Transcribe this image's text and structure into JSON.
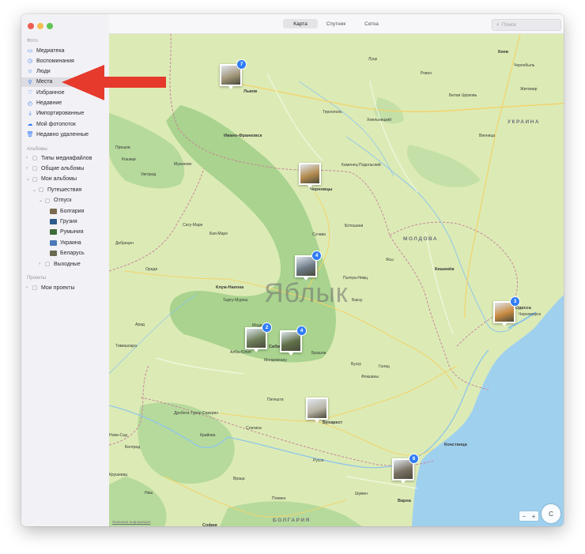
{
  "toolbar": {
    "tabs": [
      "Карта",
      "Спутник",
      "Сетка"
    ],
    "active_tab": 0,
    "search_placeholder": "Поиск"
  },
  "sidebar": {
    "sections": {
      "library": "Фото",
      "albums": "Альбомы",
      "projects": "Проекты"
    },
    "library_items": [
      {
        "label": "Медиатека",
        "icon": "photo-library-icon"
      },
      {
        "label": "Воспоминания",
        "icon": "memories-icon"
      },
      {
        "label": "Люди",
        "icon": "people-icon"
      },
      {
        "label": "Места",
        "icon": "places-pin-icon",
        "selected": true
      },
      {
        "label": "Избранное",
        "icon": "heart-icon"
      },
      {
        "label": "Недавние",
        "icon": "clock-icon"
      },
      {
        "label": "Импортированные",
        "icon": "import-icon"
      },
      {
        "label": "Мой фотопоток",
        "icon": "cloud-icon"
      },
      {
        "label": "Недавно удаленные",
        "icon": "trash-icon"
      }
    ],
    "album_items": [
      {
        "label": "Типы медиафайлов",
        "level": 0
      },
      {
        "label": "Общие альбомы",
        "level": 0
      },
      {
        "label": "Мои альбомы",
        "level": 0
      },
      {
        "label": "Путешествия",
        "level": 1
      },
      {
        "label": "Отпуск",
        "level": 2
      },
      {
        "label": "Болгария",
        "level": 3
      },
      {
        "label": "Грузия",
        "level": 3
      },
      {
        "label": "Румыния",
        "level": 3
      },
      {
        "label": "Украина",
        "level": 3
      },
      {
        "label": "Беларусь",
        "level": 3
      },
      {
        "label": "Выходные",
        "level": 2
      }
    ],
    "project_items": [
      {
        "label": "Мои проекты",
        "level": 0
      }
    ]
  },
  "map": {
    "watermark": "Яблык",
    "countries": [
      "УКРАИНА",
      "МОЛДОВА",
      "БОЛГАРИЯ"
    ],
    "cities": [
      "Киев",
      "Чернобыль",
      "Жешув",
      "Львов",
      "Луцк",
      "Ровно",
      "Житомир",
      "Тернополь",
      "Хмельницкий",
      "Белая Церковь",
      "Винница",
      "Ивано-Франковск",
      "Черновцы",
      "Каменец-Подольский",
      "Прешов",
      "Кошице",
      "Ужгород",
      "Мукачево",
      "Сату-Маре",
      "Бая-Маре",
      "Сучава",
      "Ботошани",
      "Ясы",
      "Кишинёв",
      "Клуж-Напока",
      "Тыргу-Муреш",
      "Пьятра-Нямц",
      "Бакэу",
      "Орадя",
      "Арад",
      "Тимишоара",
      "Сибиу",
      "Брашов",
      "Алба-Юлия",
      "Медиаш",
      "Молдовеану",
      "Фокшаны",
      "Галац",
      "Бузэу",
      "Питешти",
      "Бухарест",
      "Крайова",
      "Слатина",
      "Дробета-Турну-Северин",
      "Руссе",
      "Констанца",
      "Варна",
      "Шумен",
      "Плевен",
      "Ниш",
      "София",
      "Враца",
      "Одесса",
      "Черноморск",
      "Крушевац",
      "Нови-Сад",
      "Белград",
      "Дебрецен"
    ],
    "pins": [
      {
        "name": "lviv",
        "count": "7",
        "color": "#a3967a"
      },
      {
        "name": "chernivtsi",
        "count": "",
        "color": "#b38a4e"
      },
      {
        "name": "bicaz",
        "count": "4",
        "color": "#6d7a86"
      },
      {
        "name": "odesa",
        "count": "3",
        "color": "#c98a40"
      },
      {
        "name": "sibiu-a",
        "count": "2",
        "color": "#6e7f5a"
      },
      {
        "name": "sibiu-b",
        "count": "4",
        "color": "#5f7048"
      },
      {
        "name": "bucharest",
        "count": "",
        "color": "#b9b3a6"
      },
      {
        "name": "constanta",
        "count": "6",
        "color": "#7b7264"
      }
    ],
    "zoom_minus": "−",
    "zoom_plus": "+",
    "compass_label": "С",
    "legal": "Правовая информация"
  },
  "colors": {
    "accent": "#2f7cf6",
    "land": "#dcebb5",
    "forest": "#a9d38e",
    "water": "#9fd0ee",
    "arrow": "#e53a2c"
  }
}
